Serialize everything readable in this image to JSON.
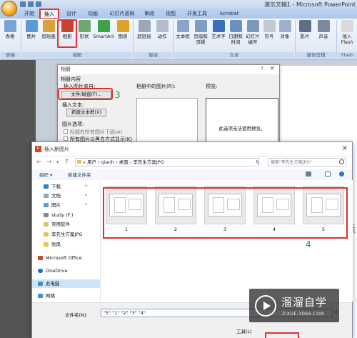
{
  "window": {
    "title": "演示文稿1 - Microsoft PowerPoint"
  },
  "ribbon_tabs": [
    "开始",
    "插入",
    "设计",
    "动画",
    "幻灯片放映",
    "审阅",
    "视图",
    "开发工具",
    "Acrobat"
  ],
  "ribbon": {
    "buttons": {
      "table": "表格",
      "picture": "图片",
      "clipart": "剪贴画",
      "album": "相册",
      "shapes": "形状",
      "smartart": "SmartArt",
      "chart": "图表",
      "hyperlink": "超链接",
      "action": "动作",
      "textbox": "文本框",
      "header_footer_1": "页眉和",
      "header_footer_2": "页脚",
      "wordart_1": "艺术字",
      "wordart_2": "",
      "datetime_1": "日期和",
      "datetime_2": "时间",
      "slideno_1": "幻灯片",
      "slideno_2": "编号",
      "symbol": "符号",
      "object": "对象",
      "movie": "影片",
      "sound": "声音",
      "flash_1": "插入",
      "flash_2": "Flash"
    },
    "groups": {
      "tables": "表格",
      "illustrations": "插图",
      "links": "链接",
      "text": "文本",
      "media": "媒体剪辑",
      "flash": "Flash"
    }
  },
  "album_dialog": {
    "title": "相册",
    "help": "?",
    "close": "×",
    "album_content": "相册内容",
    "insert_from": "插入图片来自:",
    "file_disk_btn": "文件/磁盘(F)...",
    "insert_text": "插入文本:",
    "new_textbox_btn": "新建文本框(X)",
    "picture_options": "图片选项:",
    "option_captions": "标题在所有图片下面(A)",
    "option_bw": "所有图片以黑白方式显示(K)",
    "pictures_in_album": "相册中的图片(R):",
    "preview": "预览:",
    "preview_unavailable": "此选项无法使用预览。",
    "step_label": "3"
  },
  "insert_dialog": {
    "title": "插入新图片",
    "close": "×",
    "path": "« 用户 › qianh › 桌面 › 李先生方案JPG",
    "search": {
      "placeholder": "搜索\"李先生方案JPG\""
    },
    "toolbar": {
      "organize": "组织 ▾",
      "new_folder": "新建文件夹"
    },
    "nav_items": [
      {
        "label": "下载"
      },
      {
        "label": "文档"
      },
      {
        "label": "图片"
      },
      {
        "label": "study (F:)"
      },
      {
        "label": "常用软件"
      },
      {
        "label": "李先生方案JPG"
      },
      {
        "label": "张凤"
      },
      {
        "label": "Microsoft Office"
      },
      {
        "label": "OneDrive"
      },
      {
        "label": "此电脑"
      },
      {
        "label": "网络"
      }
    ],
    "files": [
      {
        "label": "1"
      },
      {
        "label": "2"
      },
      {
        "label": "3"
      },
      {
        "label": "4"
      },
      {
        "label": "5"
      }
    ],
    "step_label": "4",
    "filename_label": "文件名(N):",
    "filename_value": "\"5\" \"1\" \"2\" \"3\" \"4\"",
    "tools_label": "工具(L)"
  },
  "watermark": {
    "title": "溜溜自学",
    "url": "ZIXUE.3D66.COM"
  },
  "slide": {
    "ghost_text": "添"
  },
  "colors": {
    "highlight_red": "#e0302f",
    "step_green": "#2b9a2b",
    "selection_blue": "#cde5f7"
  }
}
